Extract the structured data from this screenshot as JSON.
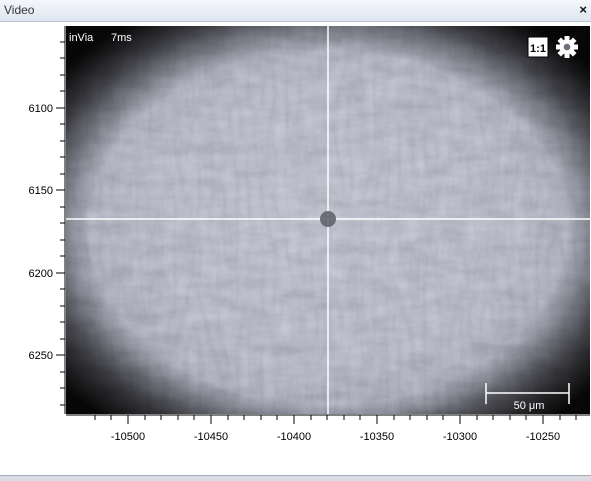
{
  "window": {
    "title": "Video"
  },
  "overlay": {
    "label": "inVia",
    "exposure": "7ms",
    "scale_bar_label": "50 μm"
  },
  "controls": {
    "one_to_one": "1:1"
  },
  "axes": {
    "x_ticks": [
      "-10500",
      "-10450",
      "-10400",
      "-10350",
      "-10300",
      "-10250"
    ],
    "y_ticks": [
      "6100",
      "6150",
      "6200",
      "6250"
    ]
  },
  "colors": {
    "crosshair": "#ffffff",
    "accent": "#2a5599"
  },
  "icons": {
    "settings": "gear-icon",
    "close": "close-icon"
  }
}
